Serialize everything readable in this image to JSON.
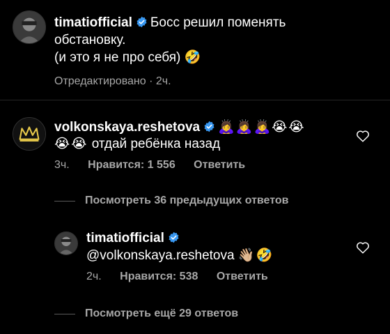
{
  "post": {
    "username": "timatiofficial",
    "caption_line1": "Босс решил поменять",
    "caption_line2": "обстановку.",
    "caption_line3": "(и это я не про себя)",
    "caption_emoji": "🤣",
    "edited_label": "Отредактировано",
    "sep": "·",
    "time": "2ч."
  },
  "comment": {
    "username": "volkonskaya.reshetova",
    "emojis_inline": [
      "🙇‍♀️",
      "🙇‍♀️",
      "🙇‍♀️",
      "😭",
      "😭"
    ],
    "emojis_line2": [
      "😭",
      "😭"
    ],
    "text": "отдай ребёнка назад",
    "time": "3ч.",
    "likes_label": "Нравится: 1 556",
    "reply_label": "Ответить",
    "view_previous": "Посмотреть 36 предыдущих ответов"
  },
  "reply": {
    "username": "timatiofficial",
    "mention": "@volkonskaya.reshetova",
    "emojis": [
      "👋🏼",
      "🤣"
    ],
    "time": "2ч.",
    "likes_label": "Нравится: 538",
    "reply_label": "Ответить",
    "view_more": "Посмотреть ещё 29 ответов"
  },
  "colors": {
    "background": "#000000",
    "text": "#ffffff",
    "meta": "#a8a8a8",
    "verified": "#3897f0",
    "divider": "#5a5a5a"
  },
  "icons": {
    "verified": "verified-badge-icon",
    "like": "heart-icon"
  }
}
